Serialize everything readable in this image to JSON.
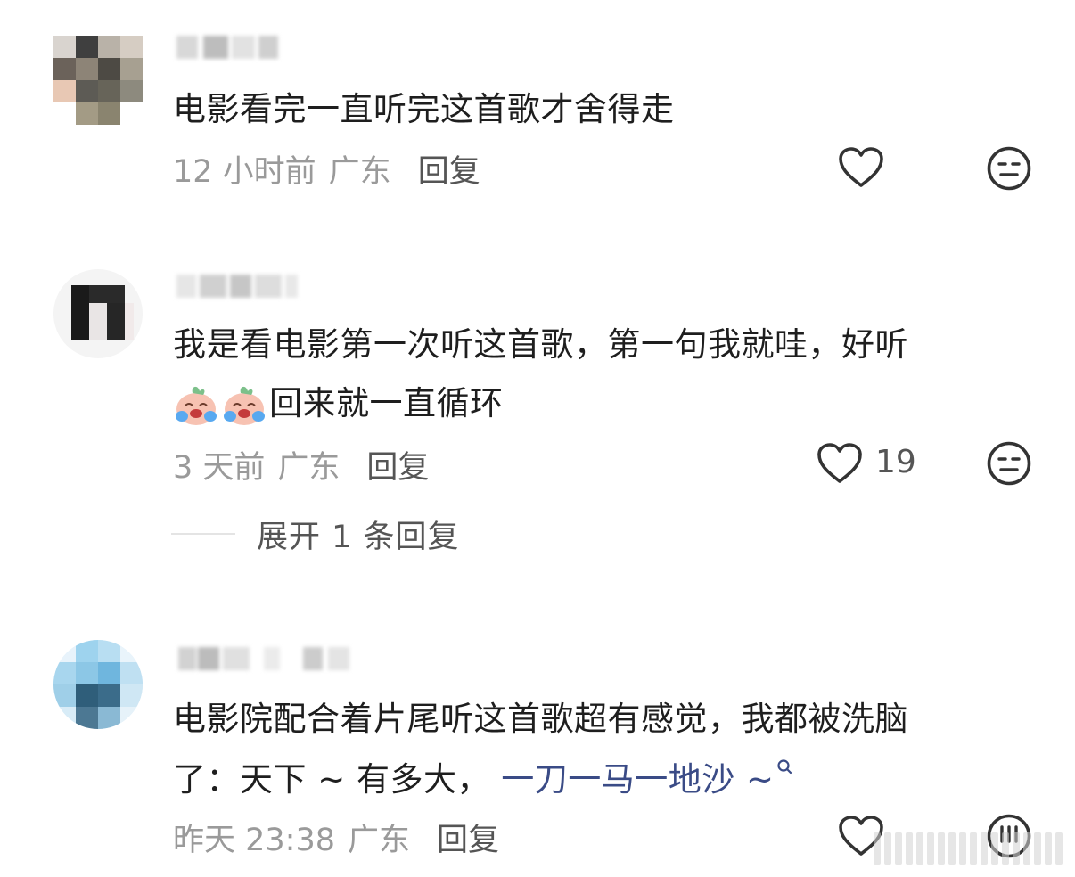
{
  "comments": [
    {
      "text": "电影看完一直听完这首歌才舍得走",
      "time": "12 小时前",
      "location": "广东",
      "reply_label": "回复"
    },
    {
      "text_line1": "我是看电影第一次听这首歌，第一句我就哇，好听",
      "text_line2": "回来就一直循环",
      "emoji": "crying-emoji",
      "time": "3 天前",
      "location": "广东",
      "reply_label": "回复",
      "like_count": "19",
      "expand_label": "展开 1 条回复"
    },
    {
      "text_line1": "电影院配合着片尾听这首歌超有感觉，我都被洗脑",
      "text_line2_plain": "了：天下 ~ 有多大，",
      "text_line2_link": "一刀一马一地沙 ~",
      "time": "昨天 23:38",
      "location": "广东",
      "reply_label": "回复"
    }
  ],
  "icons": {
    "like": "heart-outline-icon",
    "dislike": "meh-face-icon",
    "search": "search-icon"
  },
  "colors": {
    "text": "#1e1e1e",
    "meta": "#9a9a9a",
    "link": "#3a4b86",
    "icon": "#333333"
  }
}
